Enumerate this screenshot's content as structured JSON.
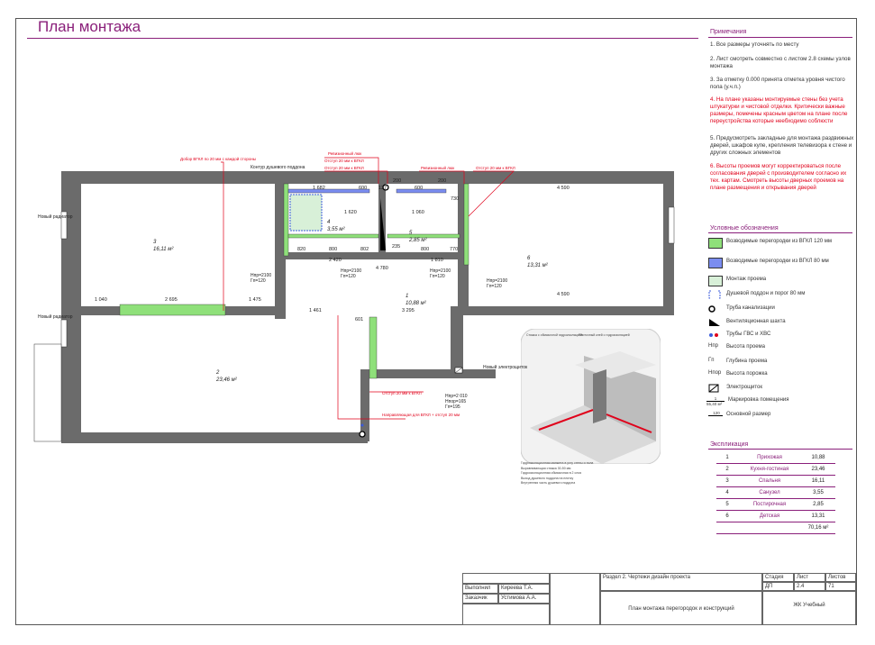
{
  "sheet": {
    "title": "План монтажа"
  },
  "notes": {
    "heading": "Примечания",
    "items": [
      {
        "text": "1. Все размеры уточнять по месту",
        "red": false
      },
      {
        "text": "2. Лист смотреть совместно с листом 2.8 схемы узлов монтажа",
        "red": false
      },
      {
        "text": "3. За отметку 0.000 принята отметка уровня чистого пола (у.ч.п.)",
        "red": false
      },
      {
        "text": "4. На плане указаны монтируемые стены без учета штукатурки и чистовой отделки. Критически важные размеры, помечены красным цветом на плане после переустройства которые неебходимо соблюсти",
        "red": true
      },
      {
        "text": "5. Предусмотреть закладные для монтажа раздвижных дверей, шкафов купе, крепления телевизора к стене и других сложных элементов",
        "red": false
      },
      {
        "text": "6. Высоты проемов могут корректироваться после согласования дверей с производителем согласно их тех. картам. Смотреть высоты дверных проемов на плане размещения и открывания дверей",
        "red": true
      }
    ]
  },
  "legend": {
    "heading": "Условные обозначения",
    "items": [
      {
        "icon": "green-wall-swatch",
        "text": "Возводимые перегородки из ВГКЛ 120 мм"
      },
      {
        "icon": "blue-wall-swatch",
        "text": "Возводимые перегородки из ВГКЛ 80 мм"
      },
      {
        "icon": "opening-swatch",
        "text": "Монтаж проема"
      },
      {
        "icon": "shower-tray-icon",
        "text": "Душевой поддон и порог 80 мм"
      },
      {
        "icon": "sewer-pipe-icon",
        "text": "Труба канализации"
      },
      {
        "icon": "vent-shaft-icon",
        "text": "Вентиляционная шахта"
      },
      {
        "icon": "water-pipes-icon",
        "text": "Трубы ГВС и ХВС"
      },
      {
        "icon": "opening-height-icon",
        "text": "Высота проема"
      },
      {
        "icon": "opening-depth-icon",
        "text": "Глубина проема"
      },
      {
        "icon": "threshold-height-icon",
        "text": "Высота порожка"
      },
      {
        "icon": "electric-panel-icon",
        "text": "Электрощиток"
      },
      {
        "icon": "room-mark-icon",
        "text": "Маркировка помещения"
      },
      {
        "icon": "main-dimension-icon",
        "text": "Основной размер"
      }
    ],
    "symbols": {
      "h_pr": "Hпр",
      "g_pr": "Гп",
      "h_por": "Hпор",
      "room_num": "1",
      "room_area": "55,40 м²",
      "dim": "120"
    }
  },
  "explication": {
    "heading": "Экспликация",
    "rows": [
      {
        "num": "1",
        "name": "Прихожая",
        "area": "10,88"
      },
      {
        "num": "2",
        "name": "Кухня-гостиная",
        "area": "23,46"
      },
      {
        "num": "3",
        "name": "Спальня",
        "area": "16,11"
      },
      {
        "num": "4",
        "name": "Санузел",
        "area": "3,55"
      },
      {
        "num": "5",
        "name": "Постирочная",
        "area": "2,85"
      },
      {
        "num": "6",
        "name": "Детская",
        "area": "13,31"
      }
    ],
    "total": "70,16 м²"
  },
  "stamp": {
    "section": "Раздел 2. Чертежи дизайн проекта",
    "col_stage": "Стадия",
    "col_sheet": "Лист",
    "col_sheets": "Листов",
    "stage": "ДП",
    "sheet": "2.4",
    "sheets": "71",
    "role1": "Выполнил",
    "name1": "Киреева Т.А.",
    "role2": "Заказчик",
    "name2": "Устимова А.А.",
    "drawing": "План монтажа перегородок и конструкций",
    "project": "ЖК Учебный"
  },
  "plan": {
    "rooms": [
      {
        "num": "1",
        "area": "10,88 м²"
      },
      {
        "num": "2",
        "area": "23,46 м²"
      },
      {
        "num": "3",
        "area": "16,11 м²"
      },
      {
        "num": "4",
        "area": "3,55 м²"
      },
      {
        "num": "5",
        "area": "2,85 м²"
      },
      {
        "num": "6",
        "area": "13,31 м²"
      }
    ],
    "dims": [
      "1 682",
      "600",
      "137",
      "200",
      "600",
      "200",
      "4 590",
      "1 620",
      "1 500",
      "820",
      "800",
      "802",
      "2 420",
      "4 780",
      "1 060",
      "730",
      "800",
      "770",
      "1 810",
      "800",
      "3 100",
      "2 950",
      "1 040",
      "2 695",
      "1 475",
      "1 461",
      "3 295",
      "4 590",
      "601",
      "1 380",
      "1 070",
      "1 926",
      "1 700",
      "235",
      "1 200",
      "800",
      "700",
      "1 080"
    ],
    "callouts": {
      "new_radiator_1": "Новый радиатор",
      "new_radiator_2": "Новый радиатор",
      "shower_contour": "Контур душевого поддона",
      "new_panel": "Новый электрощиток",
      "bevel": "Добор ВГКЛ по 20 мм с каждой стороны",
      "rev_hatch1": "Ревизионный люк",
      "offset1": "Отступ 20 мм к ВГКЛ",
      "offset2": "Отступ 20 мм к ВГКЛ",
      "rev_hatch2": "Ревизионный люк",
      "offset3": "Отступ 20 мм к ВГКЛ",
      "offset4": "Отступ 20 мм к ВГКЛ",
      "guide": "Направляющая для ВГКЛ + отступ 20 мм",
      "door_a_h": "Hпр=2100",
      "door_a_g": "Гп=120",
      "door_b_h": "Hпр=2100",
      "door_b_g": "Гп=120",
      "door_c_h": "Hпр=2100",
      "door_c_g": "Гп=120",
      "door_d_h": "Hпр=2100",
      "door_d_g": "Гп=120",
      "door_e_h": "Hпр=2100",
      "door_e_g": "Гп=120",
      "entry_h": "Hпр=2 010",
      "entry_g": "Hпор=165",
      "entry_gp": "Гп=195"
    }
  },
  "detail": {
    "caption": "Принципиальный узел монтажа душевого поддона в строительном исполнении",
    "labels": {
      "top_a": "Стяжка с обмазочной гидроизоляцией",
      "top_b": "Плиточный клей с гидроизоляцией"
    },
    "notes": [
      "Гидроизоляционная манжета в углу стены и пола",
      "Выравнивающая стяжка 30-50 мм",
      "Гидроизоляционная обмазочная в 2 слоя",
      "Выход душевого поддона на плитку",
      "Внутренняя часть душевого поддона"
    ]
  },
  "colors": {
    "accent": "#8a1f7a",
    "red": "#e0001a",
    "wall": "#6b6b6b",
    "green_wall": "#8fe07a",
    "blue_wall": "#7b8df0",
    "opening": "#d8f0d8"
  }
}
